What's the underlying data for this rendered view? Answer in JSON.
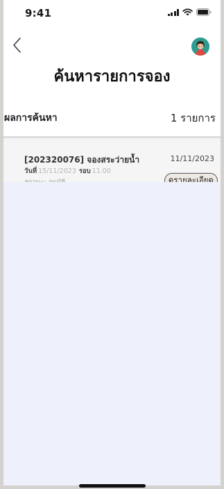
{
  "status_bar": {
    "time": "9:41"
  },
  "header": {
    "back_icon": "chevron-left-icon",
    "avatar_icon": "user-avatar-icon",
    "title": "ค้นหารายการจอง"
  },
  "results": {
    "label": "ผลการค้นหา",
    "count": "1 รายการ"
  },
  "bookings": [
    {
      "title": "[202320076] จองสระว่ายน้ำ",
      "booked_date": "11/11/2023",
      "day_label": "วันที่",
      "day_value": "15/11/2023",
      "round_label": "รอบ",
      "round_value": "11.00",
      "status": "สถานะ: อนุมัติ",
      "detail_button": "ดูรายละเอียด"
    }
  ],
  "colors": {
    "content_background": "#eef1fb",
    "card_background": "#f5f5f5",
    "button_background": "#efe9e4",
    "avatar_background": "#2e9c93"
  }
}
